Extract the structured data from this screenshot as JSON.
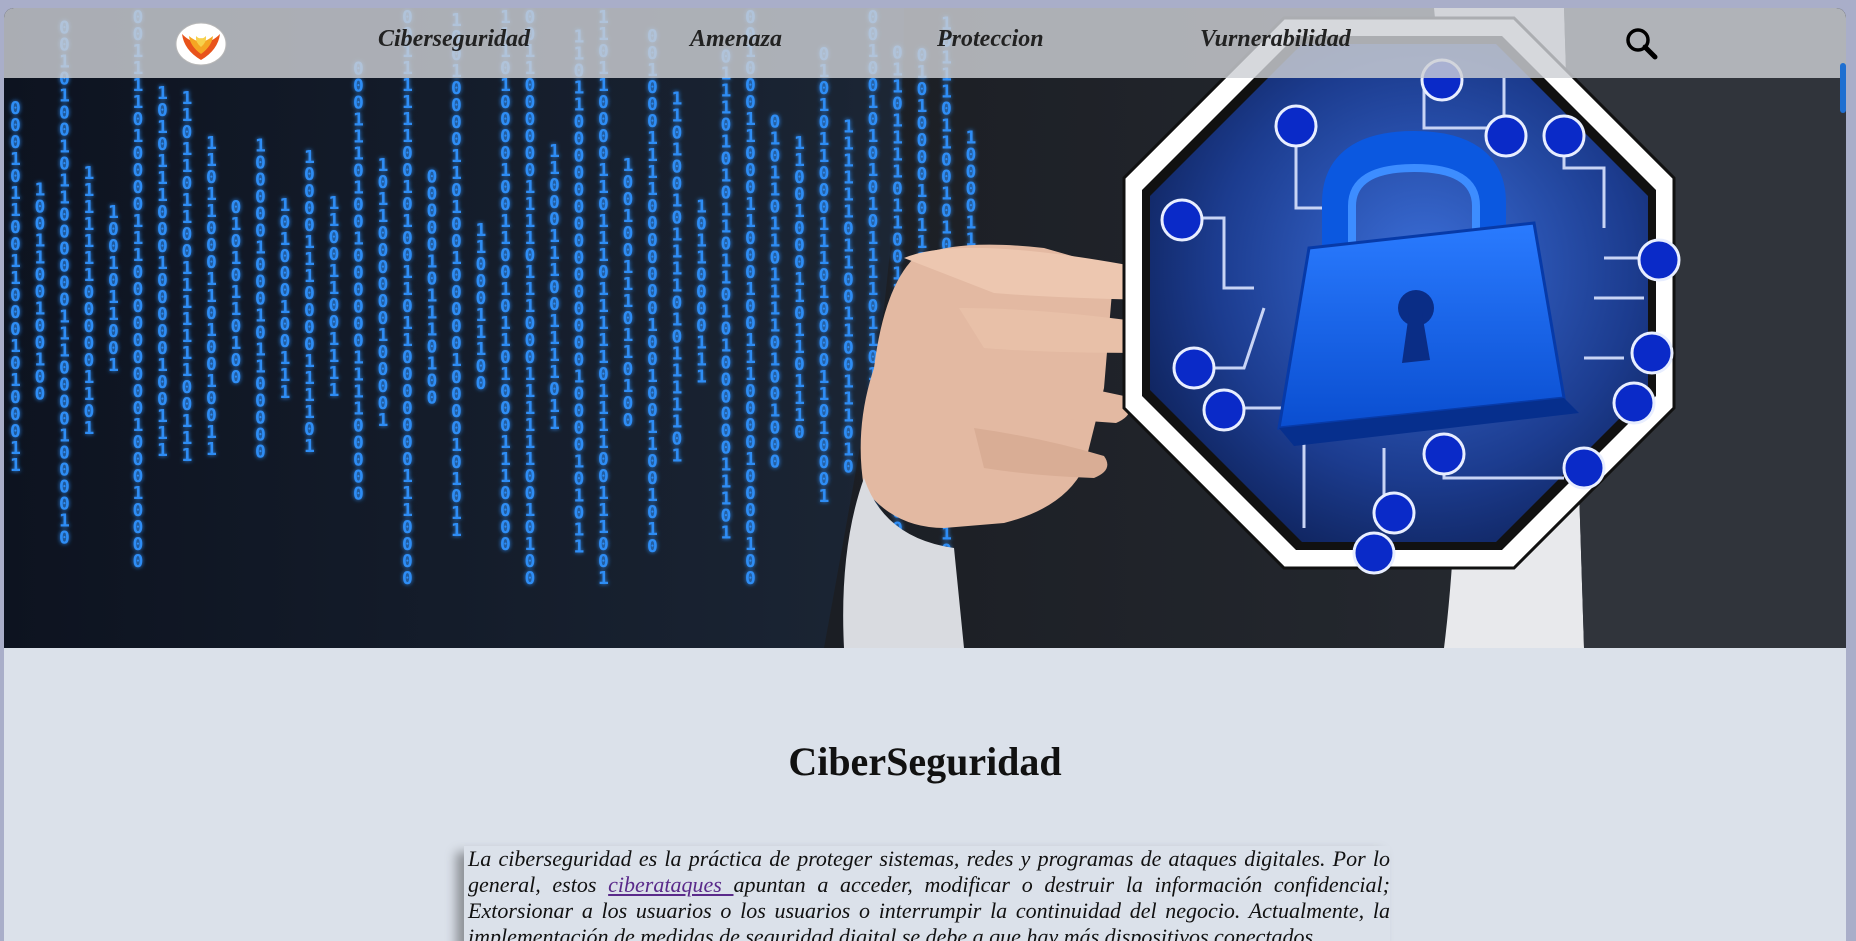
{
  "navbar": {
    "logo_icon": "phoenix-logo-icon",
    "links": [
      {
        "label": "Ciberseguridad"
      },
      {
        "label": "Amenaza"
      },
      {
        "label": "Proteccion"
      },
      {
        "label": "Vurnerabilidad"
      }
    ],
    "search_icon": "search-icon"
  },
  "hero": {
    "image_icon": "hand-holding-padlock-stop-sign-image",
    "binary_color": "#2f8df5"
  },
  "content": {
    "title": "CiberSeguridad",
    "paragraph_before_link": "La ciberseguridad es la práctica de proteger sistemas, redes y programas de ataques digitales. Por lo general, estos ",
    "link_text": "ciberataques ",
    "paragraph_after_link": "apuntan a acceder, modificar o destruir la información confidencial; Extorsionar a los usuarios o los usuarios o interrumpir la continuidad del negocio. Actualmente, la implementación de medidas de seguridad digital se debe a que hay más dispositivos conectados"
  },
  "colors": {
    "page_background": "#dbe1ea",
    "navbar_background": "#cdcfd4",
    "link_visited": "#5a2a8a",
    "accent_blue": "#1f6fd1"
  }
}
